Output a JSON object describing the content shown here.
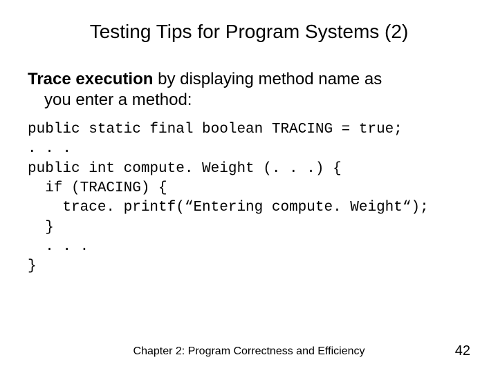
{
  "title": "Testing Tips for Program Systems (2)",
  "body": {
    "lead_bold": "Trace execution",
    "lead_rest": " by displaying method name as",
    "lead_line2": "you enter a method:"
  },
  "code": {
    "l1": "public static final boolean TRACING = true;",
    "l2": ". . .",
    "l3": "public int compute. Weight (. . .) {",
    "l4": "  if (TRACING) {",
    "l5": "    trace. printf(“Entering compute. Weight“);",
    "l6": "  }",
    "l7": "  . . .",
    "l8": "}"
  },
  "footer": {
    "chapter": "Chapter 2: Program Correctness and Efficiency",
    "page": "42"
  }
}
